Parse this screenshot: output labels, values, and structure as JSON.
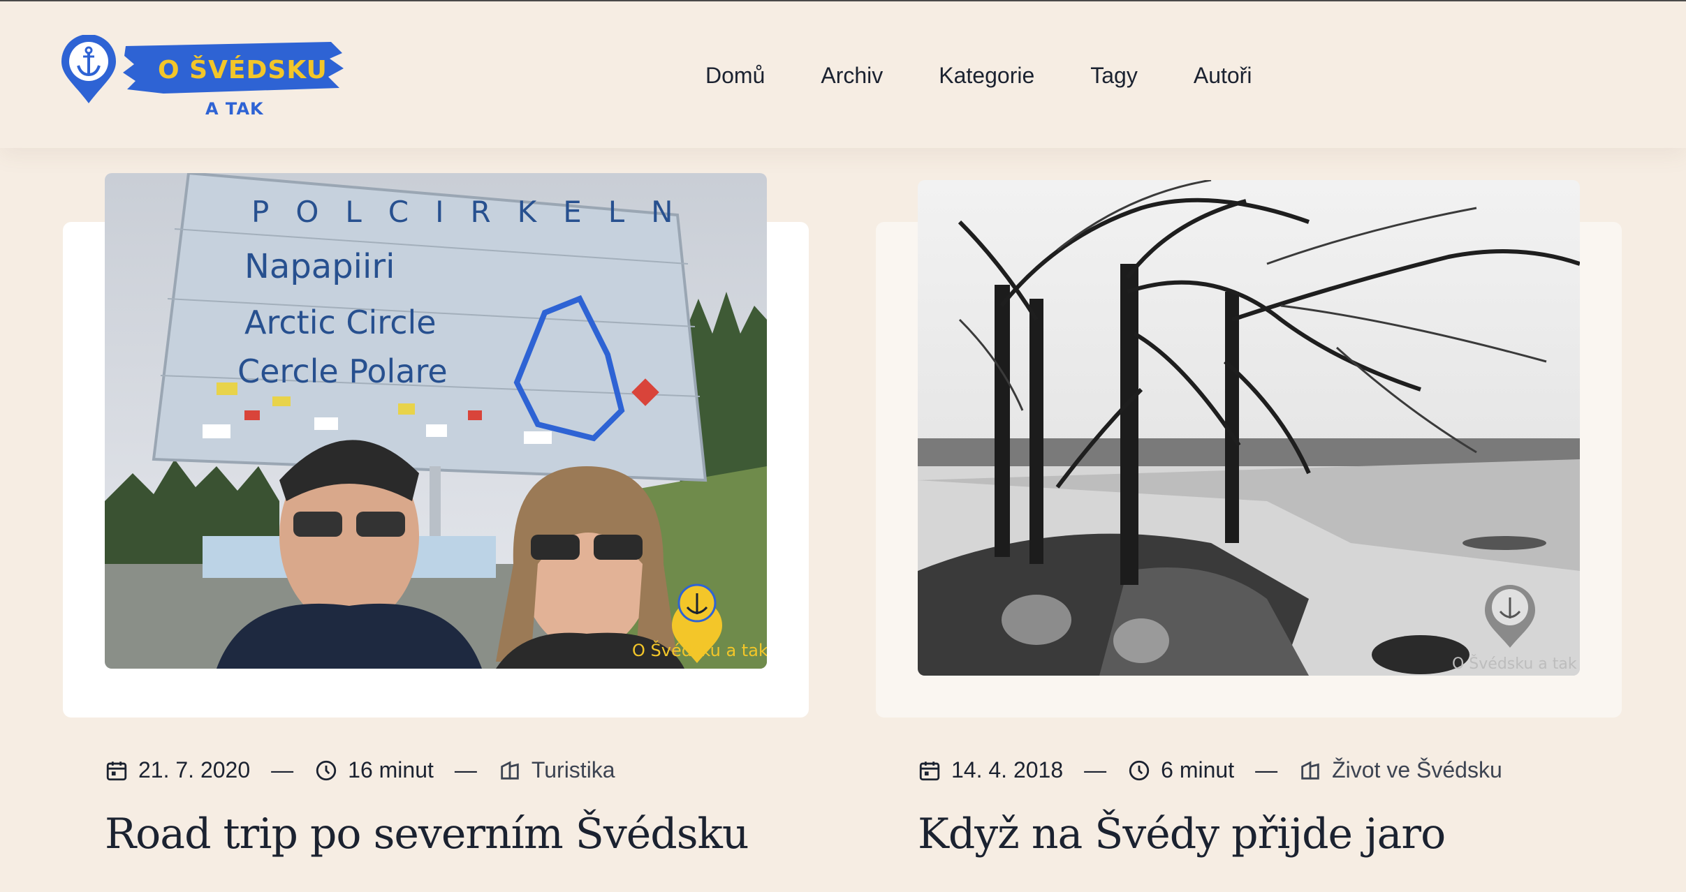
{
  "brand": {
    "line1": "O ŠVÉDSKU",
    "line2": "A TAK",
    "colors": {
      "brush": "#2e63d4",
      "text": "#f3c629",
      "pin": "#2e63d4"
    }
  },
  "nav": {
    "items": [
      {
        "label": "Domů"
      },
      {
        "label": "Archiv"
      },
      {
        "label": "Kategorie"
      },
      {
        "label": "Tagy"
      },
      {
        "label": "Autoři"
      }
    ]
  },
  "posts": [
    {
      "date": "21. 7. 2020",
      "read_time": "16 minut",
      "category": "Turistika",
      "title": "Road trip po severním Švédsku",
      "image_watermark": "O Švédsku a tak",
      "sign_lines": [
        "POLCIRKELN",
        "Napapiiri",
        "Arctic Circle",
        "Cercle Polare"
      ]
    },
    {
      "date": "14. 4. 2018",
      "read_time": "6 minut",
      "category": "Život ve Švédsku",
      "title": "Když na Švédy přijde jaro",
      "image_watermark": "O Švédsku a tak"
    }
  ],
  "icons": {
    "date": "calendar-icon",
    "time": "clock-icon",
    "category": "category-icon",
    "watermark": "anchor-pin-icon"
  }
}
